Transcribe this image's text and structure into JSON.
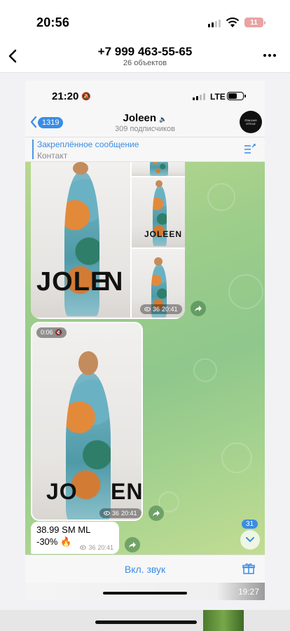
{
  "outer_status": {
    "time": "20:56",
    "battery": "11"
  },
  "outer_header": {
    "title": "+7 999 463-55-65",
    "subtitle": "26 объектов"
  },
  "inner_status": {
    "time": "21:20",
    "network": "LTE"
  },
  "channel": {
    "unread_count": "1319",
    "name": "Joleen",
    "subscribers": "309 подписчиков",
    "avatar_text": "ITALIAN STYLE"
  },
  "pinned": {
    "title": "Закреплённое сообщение",
    "text": "Контакт"
  },
  "album": {
    "brand_text_left": "JOLE",
    "brand_text_right": "N",
    "brand_small": "JOLEEN",
    "views": "36",
    "time": "20:41"
  },
  "video": {
    "duration_badge": "0:06",
    "brand_text_left": "JO",
    "brand_text_right": "EN",
    "views": "36",
    "time": "20:41"
  },
  "price_message": {
    "line1": "38.99 SM ML",
    "line2": "-30% 🔥",
    "views": "36",
    "time": "20:41"
  },
  "scroll_badge": "31",
  "bottom": {
    "sound_label": "Вкл. звук"
  },
  "video_duration": "19:27",
  "colors": {
    "accent": "#3a8ce4",
    "chat_bg": "#9ccd8a"
  },
  "icons": [
    "back-chevron-icon",
    "more-icon",
    "mute-bell-icon",
    "pinned-list-icon",
    "eye-icon",
    "share-icon",
    "chevron-down-icon",
    "gift-icon",
    "mute-speaker-icon"
  ]
}
